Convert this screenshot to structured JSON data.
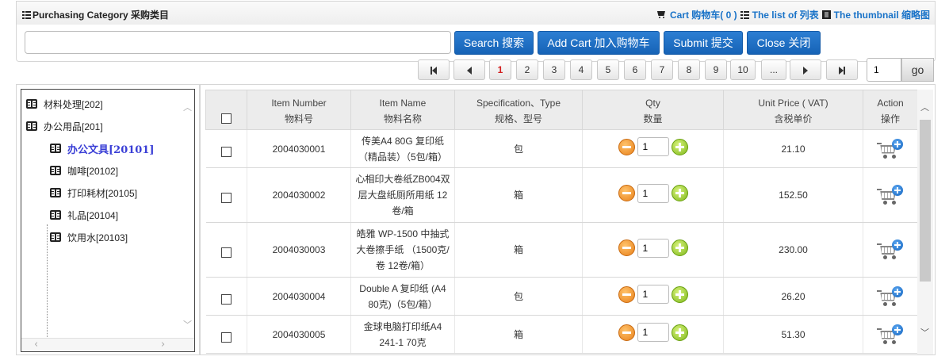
{
  "header": {
    "title": "Purchasing Category 采购类目",
    "cart_link": "Cart 购物车( 0 )",
    "list_link": "The list of 列表",
    "thumb_link": "The thumbnail 缩略图"
  },
  "search": {
    "value": "",
    "placeholder": ""
  },
  "buttons": {
    "search": "Search 搜索",
    "add_cart": "Add Cart 加入购物车",
    "submit": "Submit 提交",
    "close": "Close 关闭"
  },
  "pagination": {
    "pages": [
      "1",
      "2",
      "3",
      "4",
      "5",
      "6",
      "7",
      "8",
      "9",
      "10",
      "..."
    ],
    "current": "1",
    "jump_value": "1",
    "go_label": "go"
  },
  "tree": {
    "items": [
      {
        "label": "材料处理[202]",
        "level": 0
      },
      {
        "label": "办公用品[201]",
        "level": 0
      },
      {
        "label": "办公文具[20101]",
        "level": 1,
        "selected": true
      },
      {
        "label": "咖啡[20102]",
        "level": 1
      },
      {
        "label": "打印耗材[20105]",
        "level": 1
      },
      {
        "label": "礼品[20104]",
        "level": 1
      },
      {
        "label": "饮用水[20103]",
        "level": 1
      }
    ]
  },
  "table": {
    "headers": {
      "item_number": [
        "Item Number",
        "物料号"
      ],
      "item_name": [
        "Item Name",
        "物料名称"
      ],
      "spec": [
        "Specification、Type",
        "规格、型号"
      ],
      "qty": [
        "Qty",
        "数量"
      ],
      "price": [
        "Unit Price ( VAT)",
        "含税单价"
      ],
      "action": [
        "Action",
        "操作"
      ]
    },
    "rows": [
      {
        "number": "2004030001",
        "name": [
          "传美A4 80G 复印纸",
          "（精品装）（5包/箱）"
        ],
        "spec": "包",
        "qty": "1",
        "price": "21.10"
      },
      {
        "number": "2004030002",
        "name": [
          "心相印大卷纸ZB004双",
          "层大盘纸厕所用纸 12",
          "卷/箱"
        ],
        "spec": "箱",
        "qty": "1",
        "price": "152.50"
      },
      {
        "number": "2004030003",
        "name": [
          "皓雅 WP-1500 中抽式",
          "大卷擦手纸 （1500克/",
          "卷 12卷/箱）"
        ],
        "spec": "箱",
        "qty": "1",
        "price": "230.00"
      },
      {
        "number": "2004030004",
        "name": [
          "Double A 复印纸 (A4",
          "80克)（5包/箱）"
        ],
        "spec": "包",
        "qty": "1",
        "price": "26.20"
      },
      {
        "number": "2004030005",
        "name": [
          "金球电脑打印纸A4",
          "241-1 70克"
        ],
        "spec": "箱",
        "qty": "1",
        "price": "51.30"
      }
    ]
  },
  "colors": {
    "primary_button": "#1a6fc4",
    "link": "#1a73c8",
    "active_page": "#d21d1d",
    "selected_tree": "#3a3fd6"
  }
}
